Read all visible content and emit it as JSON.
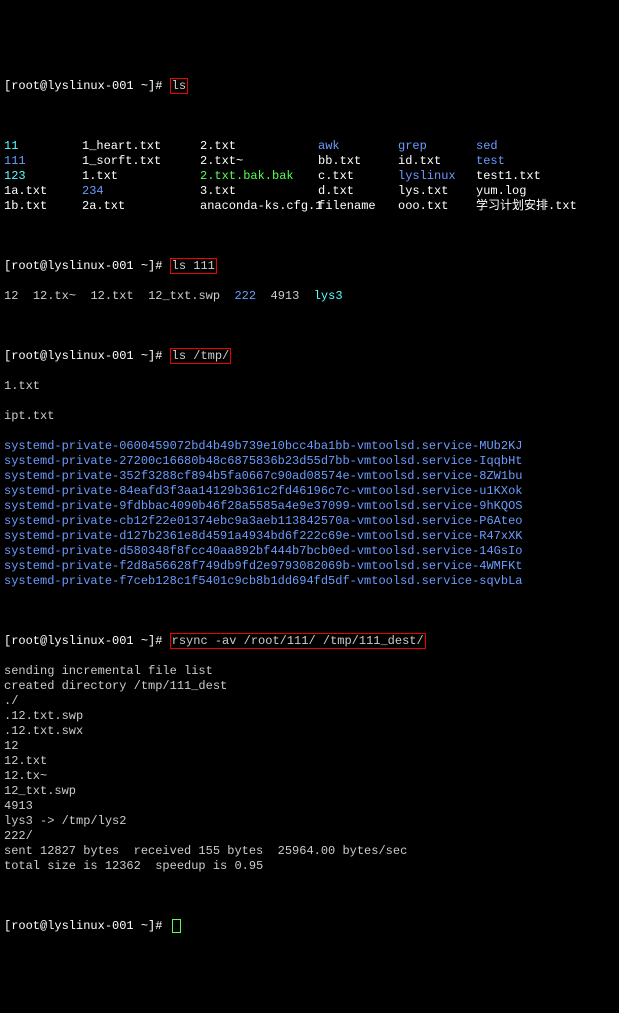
{
  "prompts": {
    "p0": "[root@lyslinux-001 ~]#",
    "cmd0": "ls",
    "cmd1": "ls 111",
    "cmd2": "ls /tmp/",
    "cmd3": "rsync -av /root/111/ /tmp/111_dest/"
  },
  "ls_root": [
    [
      "11",
      "1_heart.txt",
      "2.txt",
      "awk",
      "grep",
      "sed"
    ],
    [
      "111",
      "1_sorft.txt",
      "2.txt~",
      "bb.txt",
      "id.txt",
      "test"
    ],
    [
      "123",
      "1.txt",
      "2.txt.bak.bak",
      "c.txt",
      "lyslinux",
      "test1.txt"
    ],
    [
      "1a.txt",
      "234",
      "3.txt",
      "d.txt",
      "lys.txt",
      "yum.log"
    ],
    [
      "1b.txt",
      "2a.txt",
      "anaconda-ks.cfg.1",
      "filename",
      "ooo.txt",
      "学习计划安排.txt"
    ]
  ],
  "ls_root_color": [
    [
      "cyan",
      "white",
      "white",
      "blue",
      "blue",
      "blue"
    ],
    [
      "blue",
      "white",
      "white",
      "white",
      "white",
      "blue"
    ],
    [
      "cyan",
      "white",
      "green",
      "white",
      "blue",
      "white"
    ],
    [
      "white",
      "blue",
      "white",
      "white",
      "white",
      "white"
    ],
    [
      "white",
      "white",
      "white",
      "white",
      "white",
      "white"
    ]
  ],
  "ls_111": {
    "c0": "12",
    "c1": "12.tx~",
    "c2": "12.txt",
    "c3": "12_txt.swp",
    "c4": "222",
    "c5": "4913",
    "c6": "lys3"
  },
  "ls_tmp_top": [
    "1.txt",
    "ipt.txt"
  ],
  "systemd": [
    "systemd-private-0600459072bd4b49b739e10bcc4ba1bb-vmtoolsd.service-MUb2KJ",
    "systemd-private-27200c16680b48c6875836b23d55d7bb-vmtoolsd.service-IqqbHt",
    "systemd-private-352f3288cf894b5fa0667c90ad08574e-vmtoolsd.service-8ZW1bu",
    "systemd-private-84eafd3f3aa14129b361c2fd46196c7c-vmtoolsd.service-u1KXok",
    "systemd-private-9fdbbac4090b46f28a5585a4e9e37099-vmtoolsd.service-9hKQOS",
    "systemd-private-cb12f22e01374ebc9a3aeb113842570a-vmtoolsd.service-P6Ateo",
    "systemd-private-d127b2361e8d4591a4934bd6f222c69e-vmtoolsd.service-R47xXK",
    "systemd-private-d580348f8fcc40aa892bf444b7bcb0ed-vmtoolsd.service-14GsIo",
    "systemd-private-f2d8a56628f749db9fd2e9793082069b-vmtoolsd.service-4WMFKt",
    "systemd-private-f7ceb128c1f5401c9cb8b1dd694fd5df-vmtoolsd.service-sqvbLa"
  ],
  "rsync_out": [
    "sending incremental file list",
    "created directory /tmp/111_dest",
    "./",
    ".12.txt.swp",
    ".12.txt.swx",
    "12",
    "12.txt",
    "12.tx~",
    "12_txt.swp",
    "4913",
    "lys3 -> /tmp/lys2",
    "222/",
    "",
    "sent 12827 bytes  received 155 bytes  25964.00 bytes/sec",
    "total size is 12362  speedup is 0.95"
  ]
}
